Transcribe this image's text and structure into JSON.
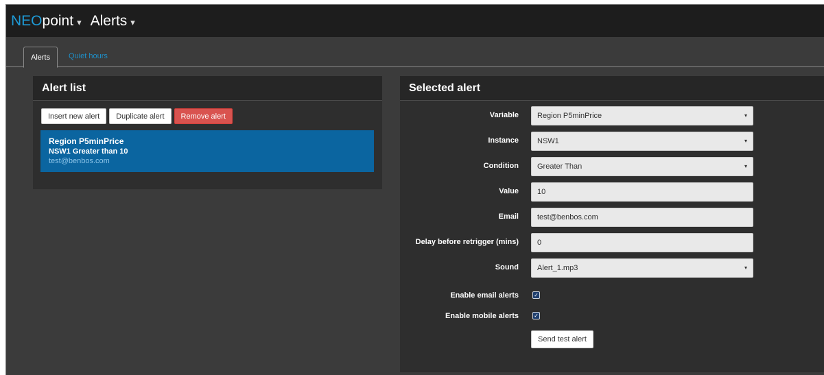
{
  "topbar": {
    "brand_accent": "NEO",
    "brand_rest": "point",
    "brand_caret": "▾",
    "page": "Alerts",
    "page_caret": "▾"
  },
  "tabs": [
    {
      "label": "Alerts",
      "active": true
    },
    {
      "label": "Quiet hours",
      "active": false
    }
  ],
  "alert_list": {
    "title": "Alert list",
    "buttons": {
      "insert": "Insert new alert",
      "duplicate": "Duplicate alert",
      "remove": "Remove alert"
    },
    "items": [
      {
        "title": "Region P5minPrice",
        "subtitle": "NSW1 Greater than 10",
        "email": "test@benbos.com",
        "selected": true
      }
    ]
  },
  "selected_alert": {
    "title": "Selected alert",
    "fields": {
      "variable": {
        "label": "Variable",
        "value": "Region P5minPrice"
      },
      "instance": {
        "label": "Instance",
        "value": "NSW1"
      },
      "condition": {
        "label": "Condition",
        "value": "Greater Than"
      },
      "value": {
        "label": "Value",
        "value": "10"
      },
      "email": {
        "label": "Email",
        "value": "test@benbos.com"
      },
      "delay": {
        "label": "Delay before retrigger (mins)",
        "value": "0"
      },
      "sound": {
        "label": "Sound",
        "value": "Alert_1.mp3"
      },
      "enable_email": {
        "label": "Enable email alerts",
        "checked": true
      },
      "enable_mobile": {
        "label": "Enable mobile alerts",
        "checked": true
      }
    },
    "send_test_label": "Send test alert"
  },
  "colors": {
    "accent": "#1e9bd7",
    "selected_item": "#0b65a0",
    "danger": "#d9534f"
  },
  "icons": {
    "select_arrow": "▾",
    "checkmark": "✓"
  }
}
